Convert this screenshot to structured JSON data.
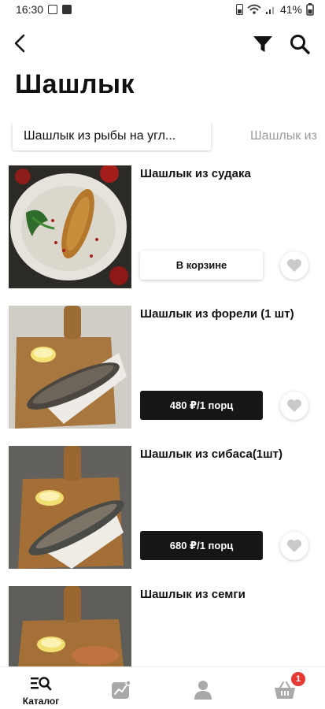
{
  "status_bar": {
    "time": "16:30",
    "battery": "41%"
  },
  "header": {
    "title": "Шашлык"
  },
  "tabs": [
    {
      "label": "Шашлык из рыбы на угл..."
    },
    {
      "label": "Шашлык из"
    }
  ],
  "products": [
    {
      "name": "Шашлык из судака",
      "action_label": "В корзине"
    },
    {
      "name": "Шашлык из форели (1 шт)",
      "action_label": "480 ₽/1 порц"
    },
    {
      "name": "Шашлык из сибаса(1шт)",
      "action_label": "680 ₽/1 порц"
    },
    {
      "name": "Шашлык из семги"
    }
  ],
  "bottom_nav": {
    "catalog_label": "Каталог",
    "cart_count": "1"
  },
  "colors": {
    "accent_dark": "#161616",
    "badge": "#e53935",
    "inactive_tab": "#9a9a9a"
  }
}
